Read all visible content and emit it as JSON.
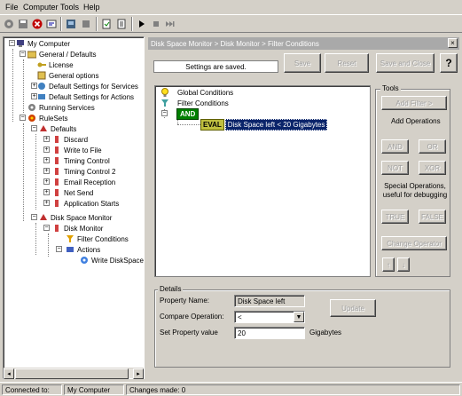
{
  "menu": {
    "file": "File",
    "computer": "Computer",
    "tools": "Tools",
    "help": "Help"
  },
  "tree": {
    "my_computer": "My Computer",
    "general_defaults": "General / Defaults",
    "license": "License",
    "general_options": "General options",
    "default_settings_services": "Default Settings for Services",
    "default_settings_actions": "Default Settings for Actions",
    "running_services": "Running Services",
    "rulesets": "RuleSets",
    "defaults": "Defaults",
    "discard": "Discard",
    "write_to_file": "Write to File",
    "timing_control": "Timing Control",
    "timing_control_2": "Timing Control 2",
    "email_reception": "Email Reception",
    "net_send": "Net Send",
    "application_starts": "Application Starts",
    "disk_space_monitor": "Disk Space Monitor",
    "disk_monitor": "Disk Monitor",
    "filter_conditions": "Filter Conditions",
    "actions": "Actions",
    "write_diskspace": "Write DiskSpace"
  },
  "panel": {
    "title": "Disk Space Monitor > Disk Monitor > Filter Conditions",
    "close": "×",
    "status_text": "Settings are saved.",
    "save": "Save",
    "reset": "Reset",
    "save_and_close": "Save and Close",
    "help": "?"
  },
  "conditions": {
    "global": "Global Conditions",
    "filter": "Filter Conditions",
    "and": "AND",
    "eval_tag": "EVAL",
    "eval_text": "Disk Space left < 20 Gigabytes"
  },
  "tools": {
    "label": "Tools",
    "add_filter": "Add Filter >",
    "add_operations": "Add Operations",
    "and": "AND",
    "or": "OR",
    "not": "NOT",
    "xor": "XOR",
    "special_ops": "Special Operations, useful for debugging",
    "true": "TRUE",
    "false": "FALSE",
    "change_operator": "Change Operator",
    "up": "↑",
    "down": "↓"
  },
  "details": {
    "label": "Details",
    "property_name_label": "Property Name:",
    "property_name_value": "Disk Space left",
    "compare_label": "Compare Operation:",
    "compare_value": "<",
    "set_value_label": "Set Property value",
    "set_value": "20",
    "unit": "Gigabytes",
    "update": "Update"
  },
  "statusbar": {
    "connected_label": "Connected to:",
    "computer": "My Computer",
    "changes": "Changes made: 0"
  }
}
